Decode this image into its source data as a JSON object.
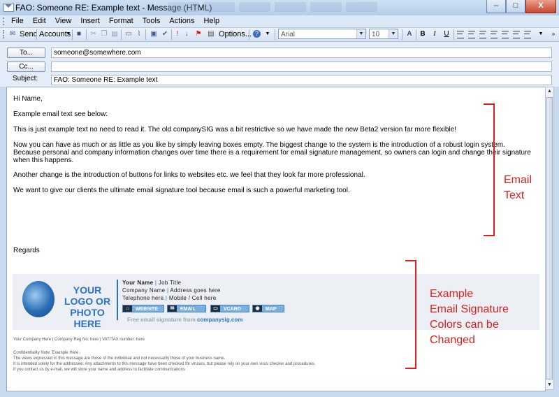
{
  "window": {
    "title": "FAO: Someone RE: Example text - Message (HTML)",
    "min": "–",
    "max": "□",
    "close": "X"
  },
  "menu": [
    {
      "key": "F",
      "rest": "ile"
    },
    {
      "key": "E",
      "rest": "dit"
    },
    {
      "key": "V",
      "rest": "iew"
    },
    {
      "key": "I",
      "rest": "nsert"
    },
    {
      "key": "F",
      "rest": "ormat",
      "pre": ""
    },
    {
      "key": "T",
      "rest": "ools"
    },
    {
      "key": "A",
      "rest": "ctions"
    },
    {
      "key": "H",
      "rest": "elp"
    }
  ],
  "menu_labels": [
    "File",
    "Edit",
    "View",
    "Insert",
    "Format",
    "Tools",
    "Actions",
    "Help"
  ],
  "toolbar": {
    "send": "Send",
    "accounts": "Accounts",
    "options": "Options...",
    "font": "Arial",
    "size": "10"
  },
  "fields": {
    "to_btn": "To...",
    "cc_btn": "Cc...",
    "subject_label": "Subject:",
    "to": "someone@somewhere.com",
    "cc": "",
    "subject": "FAO: Someone RE: Example text"
  },
  "body": {
    "greeting": "Hi Name,",
    "line1": "Example email text see below:",
    "line2": "This is just example text no need to read it.  The old companySIG was a bit restrictive so we have made the new Beta2 version far more flexible!",
    "line3": "Now you can have as much or as little as you like by simply leaving boxes empty. The biggest change to the system is the introduction of a robust login system. Because personal and company information changes over time there is a requirement for email signature management, so owners can login and change their signature when this happens.",
    "line4": "Another change is the introduction of buttons for links to websites etc. we feel that they look far more professional.",
    "line5": "We want to give our clients the ultimate email signature tool because email is such a powerful marketing tool.",
    "regards": "Regards"
  },
  "signature": {
    "logo_text": "YOUR LOGO OR PHOTO HERE",
    "name": "Your Name",
    "job": "Job Title",
    "company": "Company Name",
    "address": "Address goes here",
    "telephone": "Telephone here",
    "mobile": "Mobile / Cell here",
    "buttons": [
      "WEBSITE",
      "EMAIL",
      "VCARD",
      "MAP"
    ],
    "free_prefix": "Free email signature from ",
    "free_link": "companysig.com"
  },
  "footer": {
    "company_line": "Your Company Here | Company Reg No: here | VAT/TAX number: here",
    "conf_title": "Confidentiality Note: Example Here:",
    "conf1": "The views expressed in this message are those of the individual and not necessarily those of your business name.",
    "conf2": "It is intended solely for the addressee. Any attachments to this message have been checked for viruses, but please rely on your own virus checker and procedures.",
    "conf3": "If you contact us by e-mail, we will store your name and address to facilitate communications"
  },
  "annotations": {
    "email_text": [
      "Email",
      "Text"
    ],
    "signature": [
      "Example",
      "Email Signature",
      "Colors can be",
      "Changed"
    ]
  },
  "colors": {
    "annotation_red": "#d8201d",
    "brand_blue": "#2d72c6"
  }
}
